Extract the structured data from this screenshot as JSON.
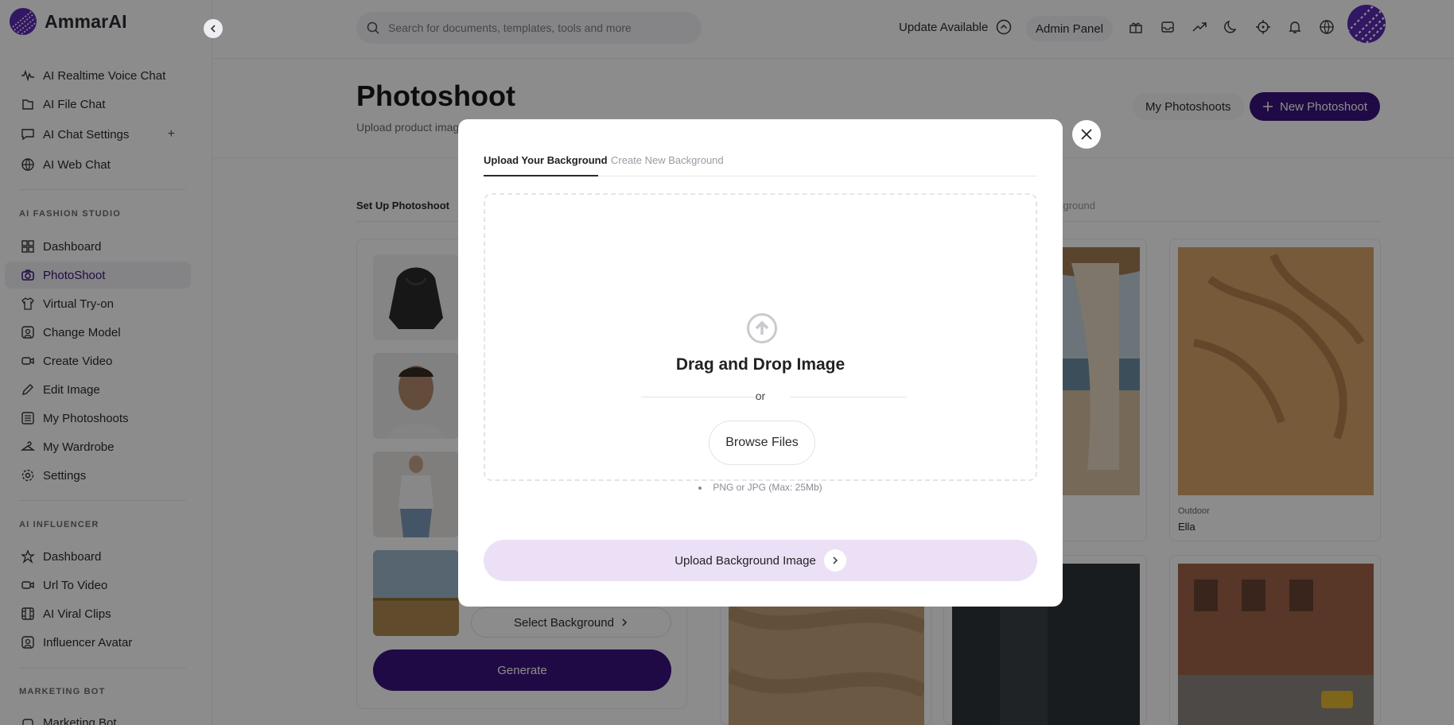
{
  "app": {
    "name": "AmmarAI",
    "brand_color": "#3a137e"
  },
  "sidebar": {
    "items_top": [
      {
        "label": "AI Realtime Voice Chat",
        "icon": "waveform-icon"
      },
      {
        "label": "AI File Chat",
        "icon": "file-icon"
      },
      {
        "label": "AI Chat Settings",
        "icon": "chat-settings-icon",
        "action": "+"
      },
      {
        "label": "AI Web Chat",
        "icon": "globe-chat-icon"
      }
    ],
    "section_fashion": "AI FASHION STUDIO",
    "fashion_items": [
      {
        "label": "Dashboard",
        "icon": "dashboard-icon"
      },
      {
        "label": "PhotoShoot",
        "icon": "camera-icon",
        "active": true
      },
      {
        "label": "Virtual Try-on",
        "icon": "shirt-icon"
      },
      {
        "label": "Change Model",
        "icon": "person-icon"
      },
      {
        "label": "Create Video",
        "icon": "video-icon"
      },
      {
        "label": "Edit Image",
        "icon": "pencil-icon"
      },
      {
        "label": "My Photoshoots",
        "icon": "list-icon"
      },
      {
        "label": "My Wardrobe",
        "icon": "hanger-icon"
      },
      {
        "label": "Settings",
        "icon": "gear-icon"
      }
    ],
    "section_influencer": "AI INFLUENCER",
    "influencer_items": [
      {
        "label": "Dashboard",
        "icon": "star-icon"
      },
      {
        "label": "Url To Video",
        "icon": "video-icon"
      },
      {
        "label": "AI Viral Clips",
        "icon": "film-icon"
      },
      {
        "label": "Influencer Avatar",
        "icon": "person-icon"
      }
    ],
    "section_marketing": "MARKETING BOT",
    "marketing_items": [
      {
        "label": "Marketing Bot",
        "icon": "bot-icon"
      }
    ]
  },
  "topbar": {
    "search_placeholder": "Search for documents, templates, tools and more",
    "update_label": "Update Available",
    "admin_label": "Admin Panel"
  },
  "main": {
    "title": "Photoshoot",
    "subtitle": "Upload product imag",
    "my_photoshoots": "My Photoshoots",
    "new_photoshoot": "New Photoshoot",
    "step_setup": "Set Up Photoshoot",
    "step_background": "kground",
    "select_background": "Select Background",
    "generate": "Generate",
    "cards": [
      {
        "category": "",
        "name": ""
      },
      {
        "category": "Outdoor",
        "name": "Ella"
      }
    ]
  },
  "modal": {
    "tab_upload": "Upload Your Background",
    "tab_create": "Create New Background",
    "drop_title": "Drag and Drop Image",
    "or_text": "or",
    "browse": "Browse Files",
    "note": "PNG or JPG (Max: 25Mb)",
    "upload_button": "Upload Background Image"
  }
}
